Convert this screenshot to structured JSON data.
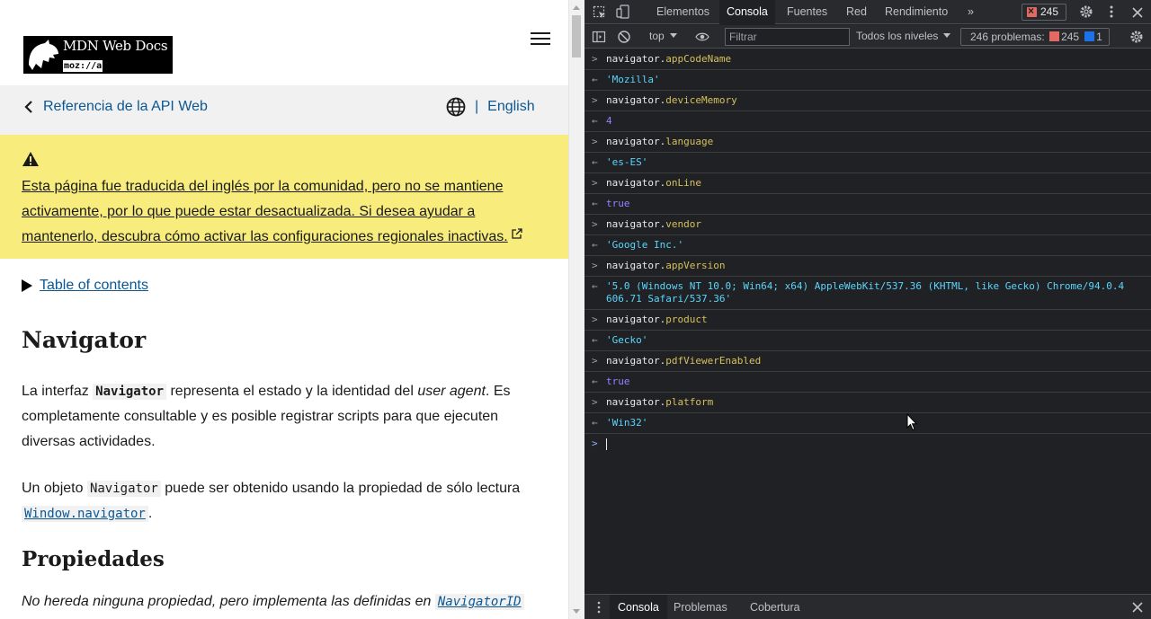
{
  "mdn": {
    "logo": {
      "title": "MDN Web Docs",
      "moz": "moz://a"
    },
    "breadcrumb": {
      "back_label": "Referencia de la API Web",
      "lang_sep": "|",
      "lang_label": "English"
    },
    "notice": {
      "text": "Esta página fue traducida del inglés por la comunidad, pero no se mantiene activamente, por lo que puede estar desactualizada. Si desea ayudar a mantenerlo, descubra cómo activar las configuraciones regionales inactivas."
    },
    "toc_label": "Table of contents",
    "title": "Navigator",
    "p1": {
      "a": "La interfaz ",
      "code": "Navigator",
      "b": " representa el estado y la identidad del ",
      "em": "user agent",
      "c": ". Es completamente consultable y es posible registrar scripts para que ejecuten diversas actividades."
    },
    "p2": {
      "a": "Un objeto ",
      "code": "Navigator",
      "b": " puede ser obtenido usando la propiedad de sólo lectura ",
      "link": "Window.navigator",
      "c": "."
    },
    "props_title": "Propiedades",
    "p3": {
      "a": "No hereda ninguna propiedad, pero implementa las definidas en ",
      "link": "NavigatorID"
    }
  },
  "devtools": {
    "tabs": [
      "Elementos",
      "Consola",
      "Fuentes",
      "Red",
      "Rendimiento"
    ],
    "active_tab": "Consola",
    "more": "»",
    "error_count": "245",
    "toolbar": {
      "context": "top",
      "filter_placeholder": "Filtrar",
      "levels": "Todos los niveles",
      "issues_label": "246 problemas:",
      "issues_errors": "245",
      "issues_info": "1"
    },
    "entries": [
      {
        "prop": "appCodeName",
        "result": "'Mozilla'",
        "type": "str"
      },
      {
        "prop": "deviceMemory",
        "result": "4",
        "type": "num"
      },
      {
        "prop": "language",
        "result": "'es-ES'",
        "type": "str"
      },
      {
        "prop": "onLine",
        "result": "true",
        "type": "bool"
      },
      {
        "prop": "vendor",
        "result": "'Google Inc.'",
        "type": "str"
      },
      {
        "prop": "appVersion",
        "result": "'5.0 (Windows NT 10.0; Win64; x64) AppleWebKit/537.36 (KHTML, like Gecko) Chrome/94.0.4606.71 Safari/537.36'",
        "type": "str"
      },
      {
        "prop": "product",
        "result": "'Gecko'",
        "type": "str"
      },
      {
        "prop": "pdfViewerEnabled",
        "result": "true",
        "type": "bool"
      },
      {
        "prop": "platform",
        "result": "'Win32'",
        "type": "str"
      }
    ],
    "object_name": "navigator",
    "drawer_tabs": [
      "Consola",
      "Problemas",
      "Cobertura"
    ],
    "drawer_active": "Consola"
  }
}
